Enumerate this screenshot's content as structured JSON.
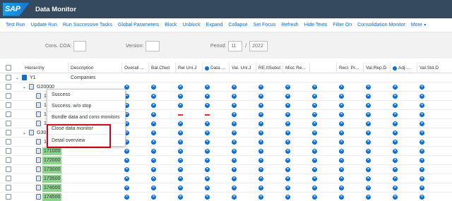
{
  "app": {
    "logo": "SAP",
    "title": "Data Monitor"
  },
  "toolbar": {
    "items": [
      "Test Run",
      "Update Run",
      "Run Successive Tasks",
      "Global Parameters",
      "Block",
      "Unblock",
      "Expand",
      "Collapse",
      "Set Focus",
      "Refresh",
      "Hide Texts",
      "Filter On",
      "Consolidation Monitor"
    ],
    "more": "More"
  },
  "header": {
    "cons_coa_label": "Cons. COA:",
    "cons_coa_value": "",
    "version_label": "Version:",
    "version_value": "",
    "period_label": "Period:",
    "period_value": "11",
    "period_sep": "/",
    "year_value": "2022"
  },
  "grid": {
    "columns": [
      "Hierarchy",
      "Description",
      "Overall ...",
      "Bal.Cfwd",
      "Rel Uni.J",
      "Data ...",
      "Val. Uni.J",
      "RE,ItSubst",
      "Misc Re...",
      "",
      "Recl. Pr...",
      "Val.Rep.D",
      "Adj-...",
      "Val.Std.D"
    ],
    "rows": [
      {
        "node": "Y1",
        "description": "Companies"
      },
      {
        "node": "G20000",
        "description": ""
      },
      {
        "node": "1",
        "description": ""
      },
      {
        "node": "1",
        "description": ""
      },
      {
        "node": "1",
        "description": ""
      },
      {
        "node": "1",
        "description": ""
      },
      {
        "node": "G30",
        "description": ""
      },
      {
        "node": "1",
        "description": ""
      },
      {
        "node": "171000",
        "description": ""
      },
      {
        "node": "172000",
        "description": ""
      },
      {
        "node": "173000",
        "description": ""
      },
      {
        "node": "173500",
        "description": ""
      },
      {
        "node": "174000",
        "description": ""
      },
      {
        "node": "174500",
        "description": ""
      }
    ]
  },
  "context_menu": {
    "items": [
      "Success",
      "Success. w/o stop",
      "Bundle data and cons monitors",
      "Close data monitor",
      "Detail overview"
    ]
  },
  "colors": {
    "shell": "#354a5f",
    "link": "#0a6ed1",
    "status_icon": "#0a6ed1",
    "highlight": "#d0021b",
    "company_cell": "#8fd18f"
  },
  "icons": {
    "status": "x-circle-icon",
    "tree_folder": "folder-icon"
  }
}
